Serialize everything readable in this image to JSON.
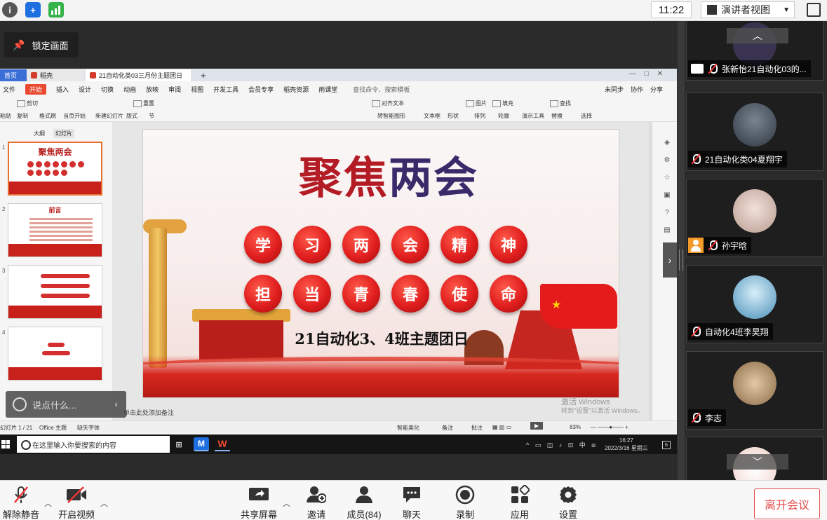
{
  "topbar": {
    "time": "11:22",
    "view_mode": "演讲者视图"
  },
  "lock_label": "锁定画面",
  "wps": {
    "tabs": {
      "home": "首页",
      "straw": "稻壳",
      "doc": "21自动化类03三月份主题团日"
    },
    "menu": [
      "文件",
      "开始",
      "插入",
      "设计",
      "切换",
      "动画",
      "放映",
      "审阅",
      "视图",
      "开发工具",
      "会员专享",
      "稻壳资源",
      "雨课堂"
    ],
    "menu_search": "查找命令、搜索模板",
    "menu_right": [
      "未同步",
      "协作",
      "分享"
    ],
    "ribbon_top": [
      "剪切",
      "重置",
      "对齐文本",
      "图片",
      "填充",
      "查找"
    ],
    "ribbon": [
      "粘贴",
      "复制",
      "格式刷",
      "当页开始",
      "新建幻灯片",
      "版式",
      "节",
      "转智能图形",
      "文本框",
      "形状",
      "排列",
      "轮廓",
      "演示工具",
      "替换",
      "选择"
    ],
    "panel_tabs": {
      "outline": "大纲",
      "slides": "幻灯片"
    },
    "thumb_title": "聚焦两会",
    "thumb2_title": "前言",
    "thumb_numbers": [
      "1",
      "2",
      "3",
      "4"
    ],
    "notes": "单击此处添加备注",
    "watermark": {
      "line1": "激活 Windows",
      "line2": "转到\"设置\"以激活 Windows。"
    },
    "status": {
      "slide": "幻灯片 1 / 21",
      "theme": "Office 主题",
      "font": "缺失字体",
      "beautify": "智能美化",
      "notes": "备注",
      "comment": "批注",
      "zoom": "83%"
    }
  },
  "slide": {
    "title_a": "聚焦",
    "title_b": "两会",
    "row1": [
      "学",
      "习",
      "两",
      "会",
      "精",
      "神"
    ],
    "row2": [
      "担",
      "当",
      "青",
      "春",
      "使",
      "命"
    ],
    "subtitle": "21自动化3、4班主题团日"
  },
  "comment_placeholder": "说点什么...",
  "taskbar": {
    "search": "在这里输入你要搜索的内容",
    "time": "16:27",
    "date": "2022/3/16 星期三",
    "ime": "中",
    "badge": "6"
  },
  "participants": [
    {
      "name": "张新怡21自动化03的...",
      "sharing": true,
      "avatar_color": "#3a3350"
    },
    {
      "name": "21自动化类04夏翔宇",
      "sharing": false,
      "avatar_color": "#4a5560"
    },
    {
      "name": "孙宇晗",
      "sharing": false,
      "avatar_color": "#d9c2b8",
      "orange_avatar": true
    },
    {
      "name": "自动化4班李昊翔",
      "sharing": false,
      "avatar_color": "#7fb5d8"
    },
    {
      "name": "李志",
      "sharing": false,
      "avatar_color": "#c6a27a"
    },
    {
      "name": "",
      "sharing": false,
      "avatar_color": "#f2e6e0"
    }
  ],
  "bottombar": {
    "unmute": "解除静音",
    "video": "开启视频",
    "share": "共享屏幕",
    "invite": "邀请",
    "members": "成员(84)",
    "chat": "聊天",
    "record": "录制",
    "apps": "应用",
    "settings": "设置",
    "leave": "离开会议"
  }
}
